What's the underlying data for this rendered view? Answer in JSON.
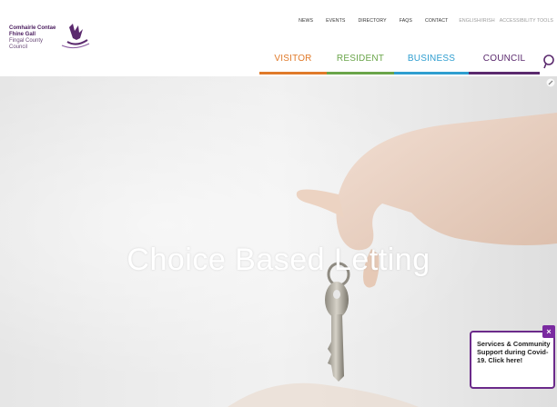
{
  "header": {
    "logo": {
      "line1": "Comhairle Contae",
      "line2": "Fhine Gall",
      "line3": "Fingal County",
      "line4": "Council"
    },
    "top_nav": {
      "news": "NEWS",
      "events": "EVENTS",
      "directory": "DIRECTORY",
      "faqs": "FAQS",
      "contact": "CONTACT",
      "language": "ENGLISH/IRISH",
      "accessibility": "ACCESSIBILITY TOOLS"
    },
    "main_nav": {
      "visitor": "VISITOR",
      "resident": "RESIDENT",
      "business": "BUSINESS",
      "council": "COUNCIL"
    },
    "icons": {
      "search": "search-icon"
    }
  },
  "hero": {
    "title": "Choice Based Letting"
  },
  "popup": {
    "text": "Services & Community Support during Covid-19. Click here!",
    "close": "×"
  },
  "colors": {
    "visitor": "#e07a2a",
    "resident": "#6aa54a",
    "business": "#2f9ed0",
    "council": "#5b2a6e",
    "popup_border": "#6b2a8a"
  }
}
